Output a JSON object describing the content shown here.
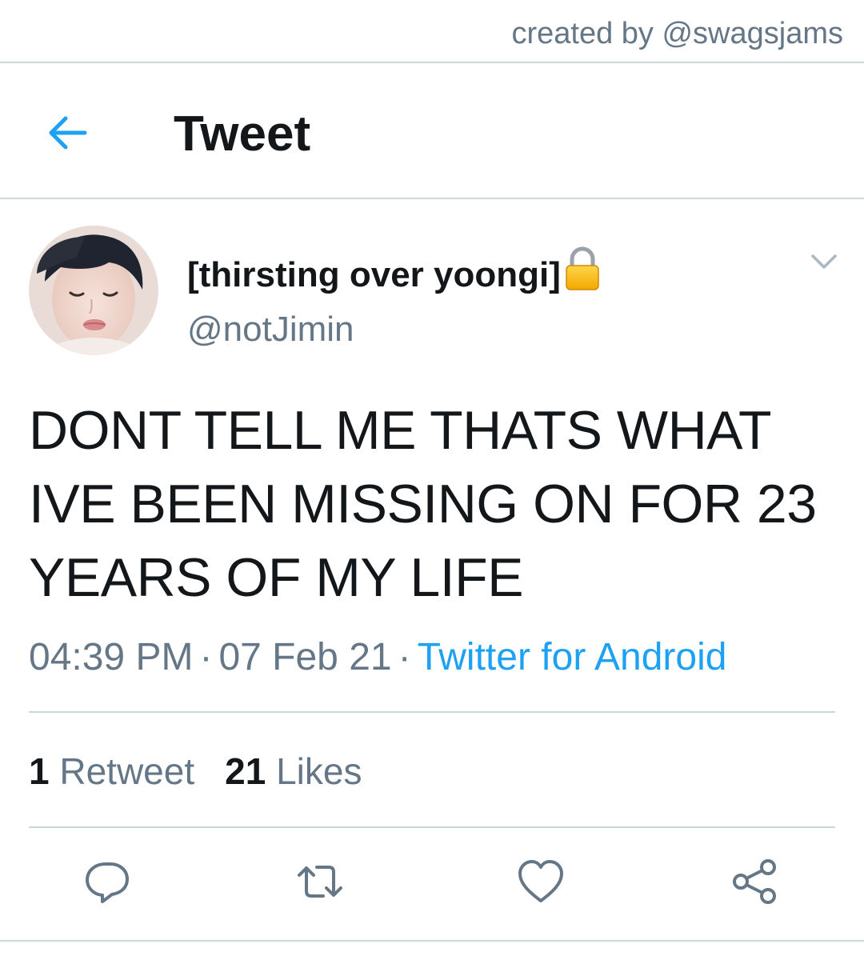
{
  "credit": "created by @swagsjams",
  "header": {
    "title": "Tweet"
  },
  "tweet": {
    "display_name": "[thirsting over yoongi]",
    "handle": "@notJimin",
    "text": "DONT TELL ME THATS WHAT IVE BEEN MISSING ON FOR 23 YEARS OF MY LIFE",
    "time": "04:39 PM",
    "date": "07 Feb 21",
    "separator": "·",
    "source": "Twitter for Android"
  },
  "stats": {
    "retweets_count": "1",
    "retweets_label": "Retweet",
    "likes_count": "21",
    "likes_label": "Likes"
  },
  "icons": {
    "back": "arrow-left-icon",
    "lock": "lock-icon",
    "caret": "chevron-down-icon",
    "reply": "reply-icon",
    "retweet": "retweet-icon",
    "like": "heart-icon",
    "share": "share-icon"
  },
  "colors": {
    "accent": "#1da1f2",
    "text_primary": "#14171a",
    "text_secondary": "#657786",
    "divider": "#ccd6dd"
  }
}
